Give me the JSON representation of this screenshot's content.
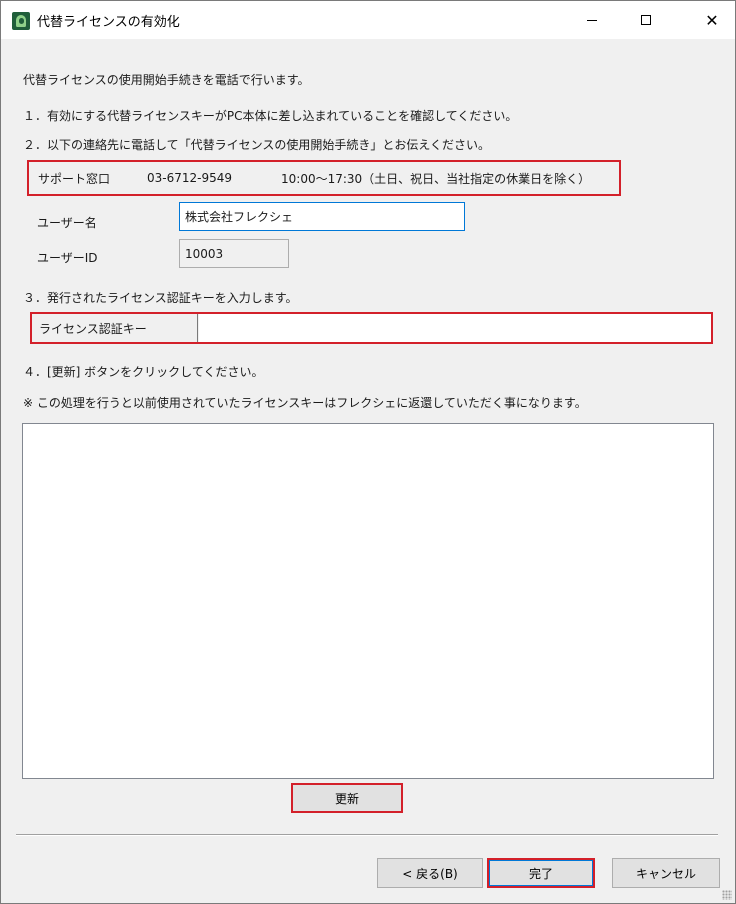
{
  "window": {
    "title": "代替ライセンスの有効化",
    "controls": {
      "minimize": "minimize",
      "maximize": "maximize",
      "close": "✕"
    }
  },
  "intro": "代替ライセンスの使用開始手続きを電話で行います。",
  "steps": {
    "step1": "１．有効にする代替ライセンスキーがPC本体に差し込まれていることを確認してください。",
    "step2": "２．以下の連絡先に電話して「代替ライセンスの使用開始手続き」とお伝えください。",
    "step3": "３．発行されたライセンス認証キーを入力します。",
    "step4": "４．[更新] ボタンをクリックしてください。",
    "note": "※ この処理を行うと以前使用されていたライセンスキーはフレクシェに返還していただく事になります。"
  },
  "support": {
    "label": "サポート窓口",
    "phone": "03-6712-9549",
    "hours": "10:00～17:30（土日、祝日、当社指定の休業日を除く）"
  },
  "user": {
    "name_label": "ユーザー名",
    "name_value": "株式会社フレクシェ",
    "id_label": "ユーザーID",
    "id_value": "10003"
  },
  "license_key": {
    "label": "ライセンス認証キー",
    "value": ""
  },
  "log_text": "",
  "buttons": {
    "update": "更新",
    "back": "< 戻る(B)",
    "finish": "完了",
    "cancel": "キャンセル"
  },
  "colors": {
    "highlight": "#d3202a",
    "focus": "#0078d7",
    "window_bg": "#f0f0f0"
  }
}
